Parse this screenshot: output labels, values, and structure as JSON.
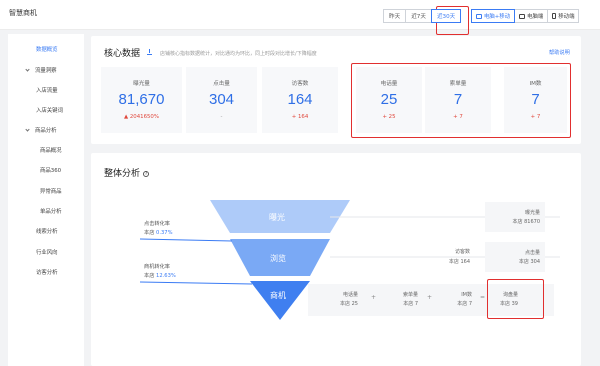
{
  "app": {
    "title": "智慧商机"
  },
  "date_range": {
    "options": [
      "昨天",
      "近7天",
      "近30天"
    ],
    "selected": "近30天"
  },
  "device": {
    "options": [
      "电脑+移动",
      "电脑端",
      "移动端"
    ],
    "selected": "电脑+移动"
  },
  "sidebar": {
    "items": [
      {
        "label": "数据概览",
        "active": true
      },
      {
        "label": "流量洞察",
        "group": true
      },
      {
        "label": "入店流量"
      },
      {
        "label": "入店关键词"
      },
      {
        "label": "商品分析",
        "group": true
      },
      {
        "label": "商品概况"
      },
      {
        "label": "商品360"
      },
      {
        "label": "异常商品"
      },
      {
        "label": "单品分析"
      },
      {
        "label": "线索分析"
      },
      {
        "label": "行业风向"
      },
      {
        "label": "访客分析"
      }
    ]
  },
  "core": {
    "title": "核心数据",
    "subtitle": "店铺核心指标数据统计，对比通均为环比，同上时段对比增长/下降幅度",
    "help": "帮助说明",
    "cards": [
      {
        "label": "曝光量",
        "value": "81,670",
        "delta": "▲ 2041650%",
        "neutral": false
      },
      {
        "label": "点击量",
        "value": "304",
        "delta": "-",
        "neutral": true
      },
      {
        "label": "访客数",
        "value": "164",
        "delta": "+ 164",
        "neutral": false
      },
      {
        "label": "电话量",
        "value": "25",
        "delta": "+ 25",
        "neutral": false
      },
      {
        "label": "索单量",
        "value": "7",
        "delta": "+ 7",
        "neutral": false
      },
      {
        "label": "IM数",
        "value": "7",
        "delta": "+ 7",
        "neutral": false
      }
    ]
  },
  "funnel": {
    "title": "整体分析",
    "stages": [
      "曝光",
      "浏览",
      "商机"
    ],
    "click_rate": {
      "label": "点击转化率",
      "store": "本店",
      "value": "0.37%"
    },
    "lead_rate": {
      "label": "商机转化率",
      "store": "本店",
      "value": "12.63%"
    },
    "exposure": {
      "label": "曝光量",
      "store": "本店",
      "value": "81670"
    },
    "visitors": {
      "label": "访客数",
      "store": "本店",
      "value": "164"
    },
    "clicks": {
      "label": "点击量",
      "store": "本店",
      "value": "304"
    },
    "phone": {
      "label": "电话量",
      "store": "本店",
      "value": "25"
    },
    "orders": {
      "label": "索单量",
      "store": "本店",
      "value": "7"
    },
    "im": {
      "label": "IM数",
      "store": "本店",
      "value": "7"
    },
    "leads": {
      "label": "询盘量",
      "store": "本店",
      "value": "39"
    },
    "ops": {
      "plus1": "+",
      "plus2": "+",
      "eq": "="
    }
  },
  "colors": {
    "accent": "#3a7bf4",
    "highlight": "#e12f2f",
    "stage1": "#aecbf9",
    "stage2": "#7aa9f5",
    "stage3": "#3f7ff0"
  }
}
